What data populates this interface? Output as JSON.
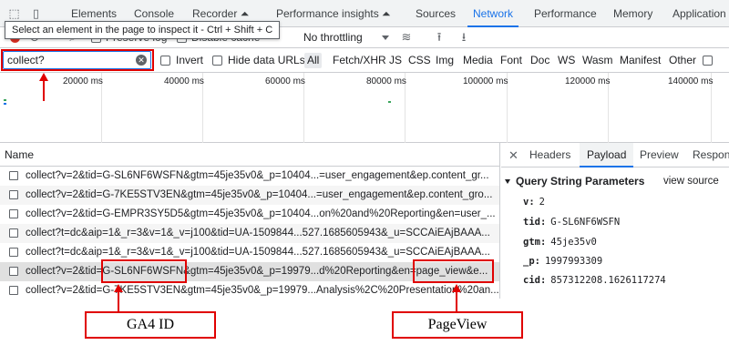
{
  "tabs": [
    {
      "label": "Elements"
    },
    {
      "label": "Console"
    },
    {
      "label": "Recorder ⏶"
    },
    {
      "label": "Performance insights ⏶"
    },
    {
      "label": "Sources"
    },
    {
      "label": "Network"
    },
    {
      "label": "Performance"
    },
    {
      "label": "Memory"
    },
    {
      "label": "Application"
    }
  ],
  "tooltip": "Select an element in the page to inspect it - Ctrl + Shift + C",
  "toolbar": {
    "preserve_log": "Preserve log",
    "disable_cache": "Disable cache",
    "throttling": "No throttling"
  },
  "filter": {
    "value": "collect?",
    "invert": "Invert",
    "hide_data_urls": "Hide data URLs",
    "types": [
      "All",
      "Fetch/XHR",
      "JS",
      "CSS",
      "Img",
      "Media",
      "Font",
      "Doc",
      "WS",
      "Wasm",
      "Manifest",
      "Other"
    ]
  },
  "timeline": {
    "ticks": [
      "20000 ms",
      "40000 ms",
      "60000 ms",
      "80000 ms",
      "100000 ms",
      "120000 ms",
      "140000 ms"
    ]
  },
  "requests": {
    "header": "Name",
    "rows": [
      "collect?v=2&tid=G-SL6NF6WSFN&gtm=45je35v0&_p=10404...=user_engagement&ep.content_gr...",
      "collect?v=2&tid=G-7KE5STV3EN&gtm=45je35v0&_p=10404...=user_engagement&ep.content_gro...",
      "collect?v=2&tid=G-EMPR3SY5D5&gtm=45je35v0&_p=10404...on%20and%20Reporting&en=user_...",
      "collect?t=dc&aip=1&_r=3&v=1&_v=j100&tid=UA-1509844...527.1685605943&_u=SCCAiEAjBAAA...",
      "collect?t=dc&aip=1&_r=3&v=1&_v=j100&tid=UA-1509844...527.1685605943&_u=SCCAiEAjBAAA...",
      "collect?v=2&tid=G-SL6NF6WSFN&gtm=45je35v0&_p=19979...d%20Reporting&en=page_view&e...",
      "collect?v=2&tid=G-7KE5STV3EN&gtm=45je35v0&_p=19979...Analysis%2C%20Presentation%20an..."
    ]
  },
  "details": {
    "tabs": [
      "Headers",
      "Payload",
      "Preview",
      "Respons"
    ],
    "section_title": "Query String Parameters",
    "view_source": "view source",
    "params": [
      {
        "key": "v:",
        "value": "2"
      },
      {
        "key": "tid:",
        "value": "G-SL6NF6WSFN"
      },
      {
        "key": "gtm:",
        "value": "45je35v0"
      },
      {
        "key": "_p:",
        "value": "1997993309"
      },
      {
        "key": "cid:",
        "value": "857312208.1626117274"
      }
    ]
  },
  "annotations": {
    "ga4_label": "GA4 ID",
    "pageview_label": "PageView"
  },
  "colors": {
    "accent_blue": "#1a73e8",
    "annotation_red": "#e00000",
    "record_red": "#d93025"
  }
}
